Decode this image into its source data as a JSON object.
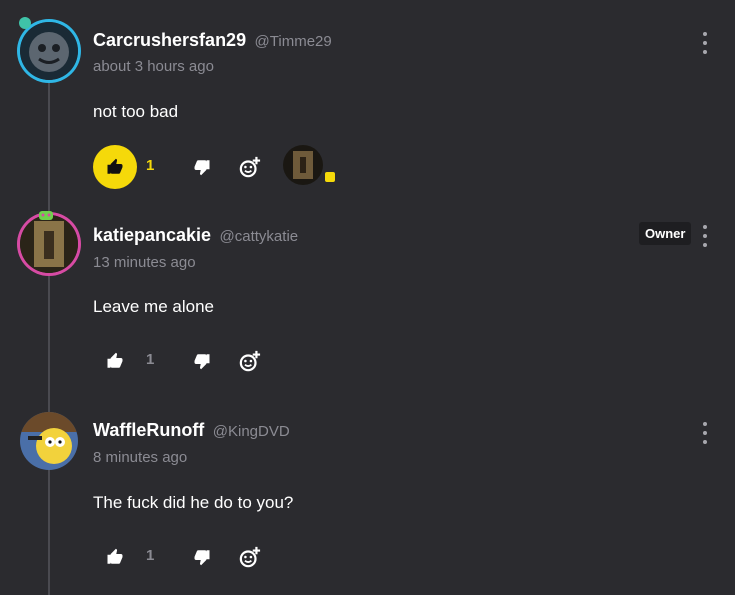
{
  "comments": [
    {
      "display_name": "Carcrushersfan29",
      "handle": "@Timme29",
      "timestamp": "about 3 hours ago",
      "body": "not too bad",
      "likes": "1",
      "liked": true,
      "ring_color": "#2fb7e6",
      "badge": ""
    },
    {
      "display_name": "katiepancakie",
      "handle": "@cattykatie",
      "timestamp": "13 minutes ago",
      "body": "Leave me alone",
      "likes": "1",
      "liked": false,
      "ring_color": "#d74ba4",
      "badge": "Owner"
    },
    {
      "display_name": "WaffleRunoff",
      "handle": "@KingDVD",
      "timestamp": "8 minutes ago",
      "body": "The fuck did he do to you?",
      "likes": "1",
      "liked": false,
      "ring_color": "",
      "badge": ""
    }
  ],
  "icons": {
    "like": "thumbs-up-icon",
    "dislike": "thumbs-down-icon",
    "react": "add-reaction-icon",
    "more": "more-vertical-icon"
  },
  "colors": {
    "background": "#2b2b2f",
    "accent": "#f5d90a",
    "muted_text": "#8b8b93"
  }
}
